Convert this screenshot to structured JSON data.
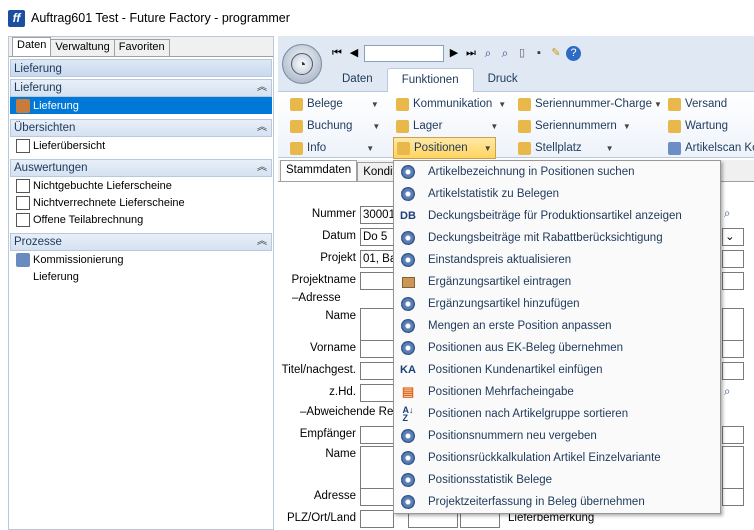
{
  "window": {
    "title": "Auftrag601 Test - Future Factory - programmer",
    "logo": "ff"
  },
  "left": {
    "tabs": [
      "Daten",
      "Verwaltung",
      "Favoriten"
    ],
    "header": "Lieferung",
    "groups": [
      {
        "title": "Lieferung",
        "items": [
          {
            "label": "Lieferung",
            "selected": true
          }
        ]
      },
      {
        "title": "Übersichten",
        "items": [
          {
            "label": "Lieferübersicht"
          }
        ]
      },
      {
        "title": "Auswertungen",
        "items": [
          {
            "label": "Nichtgebuchte Lieferscheine"
          },
          {
            "label": "Nichtverrechnete Lieferscheine"
          },
          {
            "label": "Offene Teilabrechnung"
          }
        ]
      },
      {
        "title": "Prozesse",
        "items": [
          {
            "label": "Kommissionierung"
          },
          {
            "label": "Lieferung"
          }
        ]
      }
    ]
  },
  "ribbon": {
    "tabs": [
      "Daten",
      "Funktionen",
      "Druck"
    ],
    "active_tab": "Funktionen",
    "col1": [
      "Belege",
      "Buchung",
      "Info"
    ],
    "col2": [
      "Kommunikation",
      "Lager",
      "Positionen"
    ],
    "col3": [
      "Seriennummer-Charge",
      "Seriennummern",
      "Stellplatz"
    ],
    "col4": [
      "Versand",
      "Wartung",
      "Artikelscan Ko"
    ]
  },
  "content_tabs": [
    "Stammdaten",
    "Kondit"
  ],
  "form": {
    "labels": {
      "nummer": "Nummer",
      "datum": "Datum",
      "projekt": "Projekt",
      "projektname": "Projektname",
      "adresse": "Adresse",
      "name": "Name",
      "vorname": "Vorname",
      "titel": "Titel/nachgest.",
      "zhd": "z.Hd.",
      "abw": "Abweichende Rec",
      "empfaenger": "Empfänger",
      "name2": "Name",
      "adresse2": "Adresse",
      "plz": "PLZ/Ort/Land",
      "lieferbemerkung": "Lieferbemerkung"
    },
    "values": {
      "nummer": "30001",
      "datum": "Do  5",
      "projekt": "01, Ba"
    }
  },
  "menu": {
    "items": [
      {
        "label": "Artikelbezeichnung in Positionen suchen",
        "icon": "gear"
      },
      {
        "label": "Artikelstatistik zu Belegen",
        "icon": "gear"
      },
      {
        "label": "Deckungsbeiträge für Produktionsartikel anzeigen",
        "icon": "DB"
      },
      {
        "label": "Deckungsbeiträge mit Rabattberücksichtigung",
        "icon": "gear"
      },
      {
        "label": "Einstandspreis aktualisieren",
        "icon": "gear"
      },
      {
        "label": "Ergänzungsartikel eintragen",
        "icon": "box"
      },
      {
        "label": "Ergänzungsartikel hinzufügen",
        "icon": "gear"
      },
      {
        "label": "Mengen an erste Position anpassen",
        "icon": "gear"
      },
      {
        "label": "Positionen aus EK-Beleg übernehmen",
        "icon": "gear"
      },
      {
        "label": "Positionen Kundenartikel einfügen",
        "icon": "KA"
      },
      {
        "label": "Positionen Mehrfacheingabe",
        "icon": "list-add"
      },
      {
        "label": "Positionen nach Artikelgruppe sortieren",
        "icon": "sort-az"
      },
      {
        "label": "Positionsnummern neu vergeben",
        "icon": "gear"
      },
      {
        "label": "Positionsrückkalkulation Artikel Einzelvariante",
        "icon": "gear"
      },
      {
        "label": "Positionsstatistik Belege",
        "icon": "gear"
      },
      {
        "label": "Projektzeiterfassung in Beleg übernehmen",
        "icon": "gear"
      }
    ]
  }
}
